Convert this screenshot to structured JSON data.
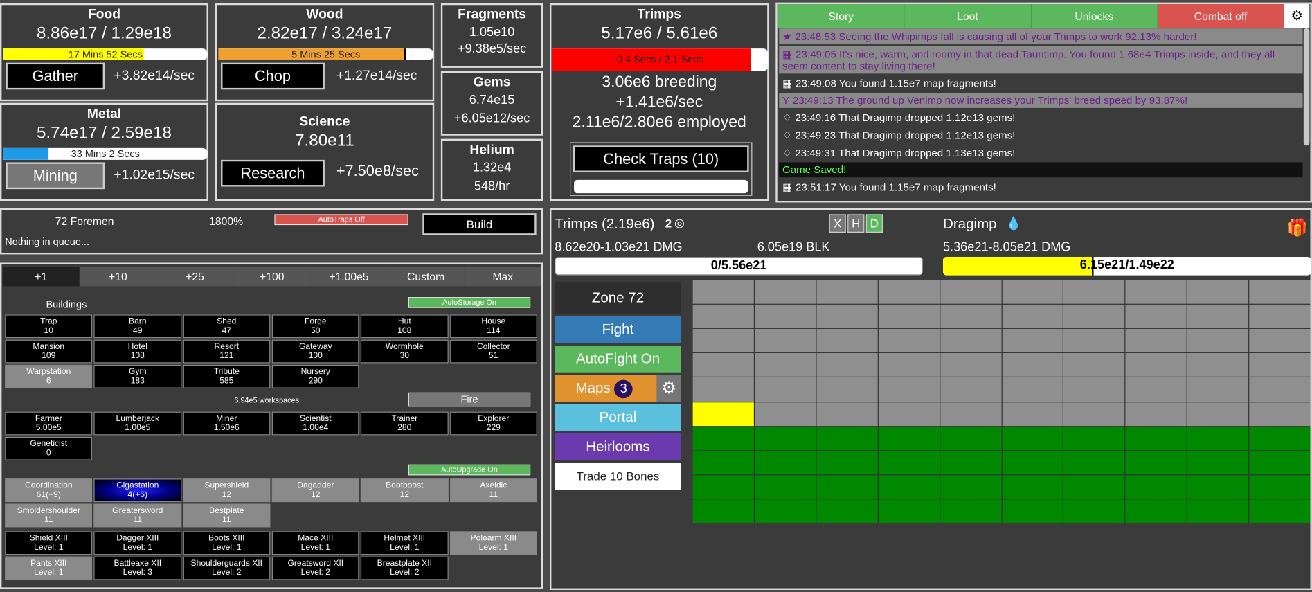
{
  "resources": {
    "food": {
      "title": "Food",
      "value": "8.86e17 / 1.29e18",
      "bar_text": "17 Mins 52 Secs",
      "fill": 0.69,
      "button": "Gather",
      "rate": "+3.82e14/sec"
    },
    "wood": {
      "title": "Wood",
      "value": "2.82e17 / 3.24e17",
      "bar_text": "5 Mins 25 Secs",
      "fill": 0.87,
      "button": "Chop",
      "rate": "+1.27e14/sec"
    },
    "metal": {
      "title": "Metal",
      "value": "5.74e17 / 2.59e18",
      "bar_text": "33 Mins 2 Secs",
      "fill": 0.22,
      "button": "Mining",
      "rate": "+1.02e15/sec"
    },
    "science": {
      "title": "Science",
      "value": "7.80e11",
      "button": "Research",
      "rate": "+7.50e8/sec"
    },
    "fragments": {
      "title": "Fragments",
      "value": "1.05e10",
      "rate": "+9.38e5/sec"
    },
    "gems": {
      "title": "Gems",
      "value": "6.74e15",
      "rate": "+6.05e12/sec"
    },
    "helium": {
      "title": "Helium",
      "value": "1.32e4",
      "rate": "548/hr"
    }
  },
  "trimps": {
    "title": "Trimps",
    "value": "5.17e6 / 5.61e6",
    "bar_text": "0.4 Secs / 2.1 Secs",
    "fill": 0.93,
    "breeding": "3.06e6 breeding",
    "rate": "+1.41e6/sec",
    "employed": "2.11e6/2.80e6 employed",
    "check_traps": "Check Traps (10)"
  },
  "log": {
    "tabs": [
      "Story",
      "Loot",
      "Unlocks",
      "Combat off"
    ],
    "gear": "⚙",
    "rows": [
      {
        "t": "23:48:53 Seeing the Whipimps fall is causing all of your Trimps to work 92.13% harder!",
        "cls": "gray",
        "icon": "★"
      },
      {
        "t": "23:49:05 It's nice, warm, and roomy in that dead Tauntimp. You found 1.68e4 Trimps inside, and they all seem content to stay living there!",
        "cls": "gray",
        "icon": "▦"
      },
      {
        "t": "23:49:08 You found 1.15e7 map fragments!",
        "cls": "",
        "icon": "▦"
      },
      {
        "t": "23:49:13 The ground up Venimp now increases your Trimps' breed speed by 93.87%!",
        "cls": "gray",
        "icon": "Y"
      },
      {
        "t": "23:49:16 That Dragimp dropped 1.12e13 gems!",
        "cls": "",
        "icon": "♢"
      },
      {
        "t": "23:49:23 That Dragimp dropped 1.12e13 gems!",
        "cls": "",
        "icon": "♢"
      },
      {
        "t": "23:49:31 That Dragimp dropped 1.13e13 gems!",
        "cls": "",
        "icon": "♢"
      },
      {
        "t": "Game Saved!",
        "cls": "dark",
        "icon": ""
      },
      {
        "t": "23:51:17 You found 1.15e7 map fragments!",
        "cls": "",
        "icon": "▦"
      }
    ]
  },
  "queue": {
    "foremen": "72 Foremen",
    "percent": "1800%",
    "autotraps": "AutoTraps Off",
    "build": "Build",
    "status": "Nothing in queue..."
  },
  "buy_tabs": [
    "+1",
    "+10",
    "+25",
    "+100",
    "+1.00e5",
    "Custom",
    "Max"
  ],
  "buildings": {
    "header": "Buildings",
    "autostorage": "AutoStorage On",
    "items": [
      [
        "Trap",
        "10"
      ],
      [
        "Barn",
        "49"
      ],
      [
        "Shed",
        "47"
      ],
      [
        "Forge",
        "50"
      ],
      [
        "Hut",
        "108"
      ],
      [
        "House",
        "114"
      ],
      [
        "Mansion",
        "109"
      ],
      [
        "Hotel",
        "108"
      ],
      [
        "Resort",
        "121"
      ],
      [
        "Gateway",
        "100"
      ],
      [
        "Wormhole",
        "30"
      ],
      [
        "Collector",
        "51"
      ],
      [
        "Warpstation",
        "6"
      ],
      [
        "Gym",
        "183"
      ],
      [
        "Tribute",
        "585"
      ],
      [
        "Nursery",
        "290"
      ]
    ]
  },
  "jobs": {
    "workspaces": "6.94e5 workspaces",
    "fire": "Fire",
    "items": [
      [
        "Farmer",
        "5.00e5"
      ],
      [
        "Lumberjack",
        "1.00e5"
      ],
      [
        "Miner",
        "1.50e6"
      ],
      [
        "Scientist",
        "1.00e4"
      ],
      [
        "Trainer",
        "280"
      ],
      [
        "Explorer",
        "229"
      ],
      [
        "Geneticist",
        "0"
      ]
    ]
  },
  "upgrades": {
    "autoupgrade": "AutoUpgrade On",
    "items": [
      [
        "Coordination",
        "61(+9)"
      ],
      [
        "Gigastation",
        "4(+6)"
      ],
      [
        "Supershield",
        "12"
      ],
      [
        "Dagadder",
        "12"
      ],
      [
        "Bootboost",
        "12"
      ],
      [
        "Axeidic",
        "11"
      ],
      [
        "Smoldershoulder",
        "11"
      ],
      [
        "Greatersword",
        "11"
      ],
      [
        "Bestplate",
        "11"
      ]
    ]
  },
  "equipment": {
    "items": [
      [
        "Shield XIII",
        "Level: 1"
      ],
      [
        "Dagger XIII",
        "Level: 1"
      ],
      [
        "Boots XIII",
        "Level: 1"
      ],
      [
        "Mace XIII",
        "Level: 1"
      ],
      [
        "Helmet XIII",
        "Level: 1"
      ],
      [
        "Polearm XIII",
        "Level: 1"
      ],
      [
        "Pants XIII",
        "Level: 1"
      ],
      [
        "Battleaxe XII",
        "Level: 3"
      ],
      [
        "Shoulderguards XII",
        "Level: 2"
      ],
      [
        "Greatsword XII",
        "Level: 2"
      ],
      [
        "Breastplate XII",
        "Level: 2"
      ]
    ]
  },
  "battle": {
    "trimps_title": "Trimps (2.19e6)",
    "trimps_count": "2",
    "trimps_dmg": "8.62e20-1.03e21 DMG",
    "trimps_blk": "6.05e19 BLK",
    "trimps_health": "0/5.56e21",
    "trimps_health_fill": 0.0,
    "enemy_title": "Dragimp",
    "enemy_dmg": "5.36e21-8.05e21 DMG",
    "enemy_health": "6.15e21/1.49e22",
    "enemy_health_fill": 0.41,
    "xhd": [
      "X",
      "H",
      "D"
    ]
  },
  "side": {
    "zone": "Zone 72",
    "fight": "Fight",
    "autofight": "AutoFight On",
    "maps": "Maps",
    "maps_count": "3",
    "portal": "Portal",
    "heirlooms": "Heirlooms",
    "trade": "Trade 10 Bones"
  },
  "colors": {
    "food_bar": "#ffff00",
    "wood_bar": "#f0a030",
    "metal_bar": "#1e9be8",
    "trimps_bar": "#ff0000",
    "fight": "#337ab7",
    "autofight": "#5cb85c",
    "maps": "#e0922e",
    "portal": "#5bc0de",
    "heirlooms": "#6b3aaf",
    "combat_off": "#d9534f",
    "grid_cleared": "#008800"
  }
}
